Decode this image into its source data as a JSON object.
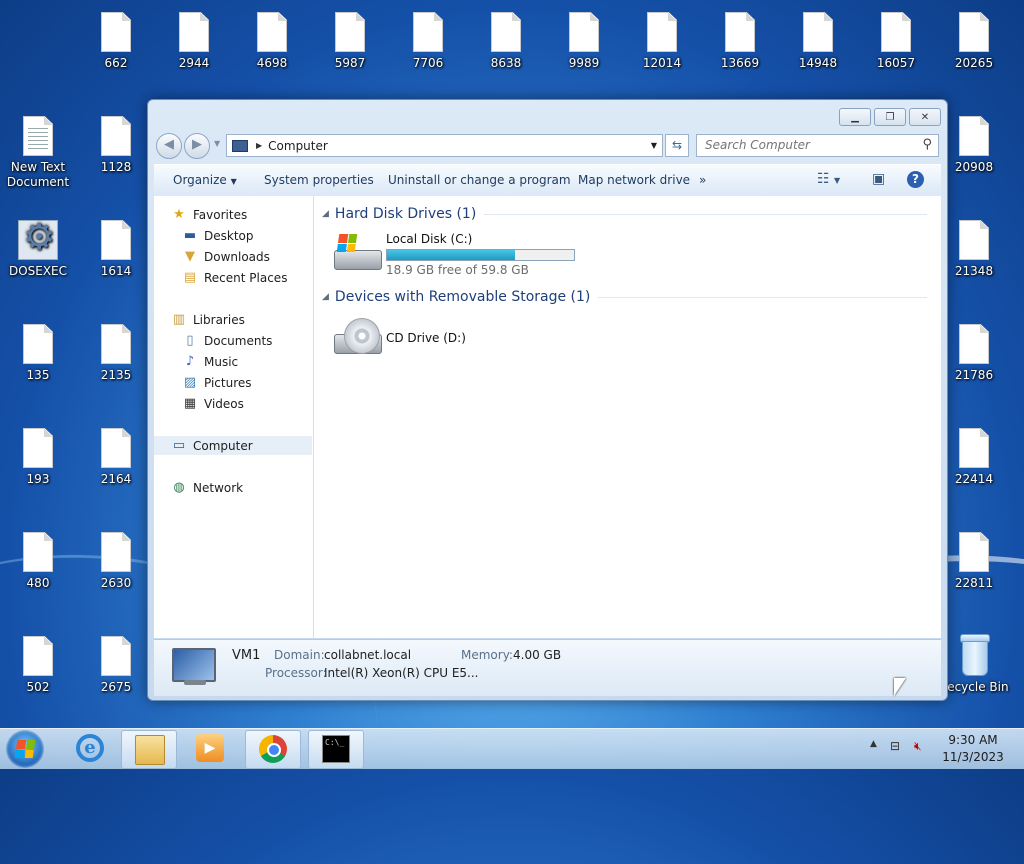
{
  "desktop": {
    "top_row": [
      "662",
      "2944",
      "4698",
      "5987",
      "7706",
      "8638",
      "9989",
      "12014",
      "13669",
      "14948",
      "16057",
      "20265"
    ],
    "left_col1": [
      "New Text Document",
      "DOSEXEC",
      "135",
      "193",
      "480",
      "502"
    ],
    "left_col2": [
      "1128",
      "1614",
      "2135",
      "2164",
      "2630",
      "2675"
    ],
    "right_col": [
      "20908",
      "21348",
      "21786",
      "22414",
      "22811",
      "Recycle Bin"
    ]
  },
  "window": {
    "address": "Computer",
    "search_placeholder": "Search Computer",
    "toolbar": {
      "organize": "Organize",
      "system_properties": "System properties",
      "uninstall": "Uninstall or change a program",
      "map_drive": "Map network drive",
      "more": "»"
    },
    "nav": {
      "favorites": "Favorites",
      "desktop": "Desktop",
      "downloads": "Downloads",
      "recent": "Recent Places",
      "libraries": "Libraries",
      "documents": "Documents",
      "music": "Music",
      "pictures": "Pictures",
      "videos": "Videos",
      "computer": "Computer",
      "network": "Network"
    },
    "groups": {
      "hdd_title": "Hard Disk Drives (1)",
      "removable_title": "Devices with Removable Storage (1)"
    },
    "drives": {
      "c_name": "Local Disk (C:)",
      "c_free": "18.9 GB free of 59.8 GB",
      "c_used_fraction": 0.684,
      "d_name": "CD Drive (D:)"
    },
    "details": {
      "name": "VM1",
      "domain_label": "Domain:",
      "domain_value": "collabnet.local",
      "memory_label": "Memory:",
      "memory_value": "4.00 GB",
      "processor_label": "Processor:",
      "processor_value": "Intel(R) Xeon(R) CPU E5..."
    }
  },
  "taskbar": {
    "time": "9:30 AM",
    "date": "11/3/2023",
    "cmd_glyph": "C:\\_"
  }
}
